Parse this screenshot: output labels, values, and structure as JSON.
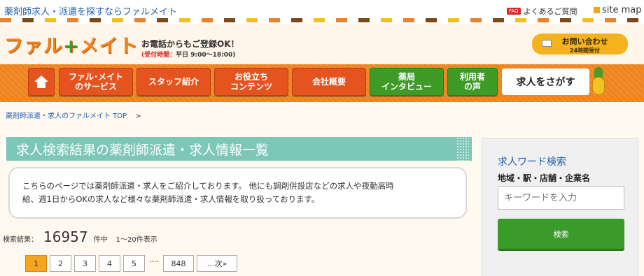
{
  "top": {
    "tagline": "薬剤師求人・派遣を探すならファルメイト",
    "faq_badge": "FAQ",
    "faq_label": "よくあるご質問",
    "sitemap_label": "site map"
  },
  "header": {
    "logo_part1": "ファル",
    "logo_plus": "+",
    "logo_part2": "メイト",
    "phone_text": "お電話からもご登録OK！",
    "phone_hours_label": "(受付時間：",
    "phone_hours_value": "平日 9:00〜18:00)",
    "contact_label": "お問い合わせ",
    "contact_sub": "24時間受付"
  },
  "nav": {
    "items": [
      {
        "label": "ファル･メイト\nのサービス"
      },
      {
        "label": "スタッフ紹介"
      },
      {
        "label": "お役立ち\nコンテンツ"
      },
      {
        "label": "会社概要"
      },
      {
        "label": "薬局\nインタビュー"
      },
      {
        "label": "利用者\nの声"
      }
    ],
    "search_label": "求人をさがす"
  },
  "breadcrumb": {
    "home": "薬剤師派遣・求人のファルメイト TOP",
    "sep": ">"
  },
  "main": {
    "heading": "求人検索結果の薬剤師派遣・求人情報一覧",
    "intro_line1": "こちらのページでは薬剤師派遣・求人をご紹介しております。 他にも調剤併設店などの求人や夜勤高時",
    "intro_line2": "給、週1日からOKの求人など様々な薬剤師派遣・求人情報を取り扱っております。",
    "result_label": "検索結果：",
    "result_count": "16957",
    "result_unit": "件中",
    "result_range": "1〜20件表示"
  },
  "pager": {
    "pages": [
      "1",
      "2",
      "3",
      "4",
      "5"
    ],
    "ellipsis": "....",
    "last": "848",
    "next": "…次»"
  },
  "sidebar": {
    "title": "求人ワード検索",
    "label": "地域・駅・店舗・企業名",
    "placeholder": "キーワードを入力",
    "button": "検索"
  }
}
